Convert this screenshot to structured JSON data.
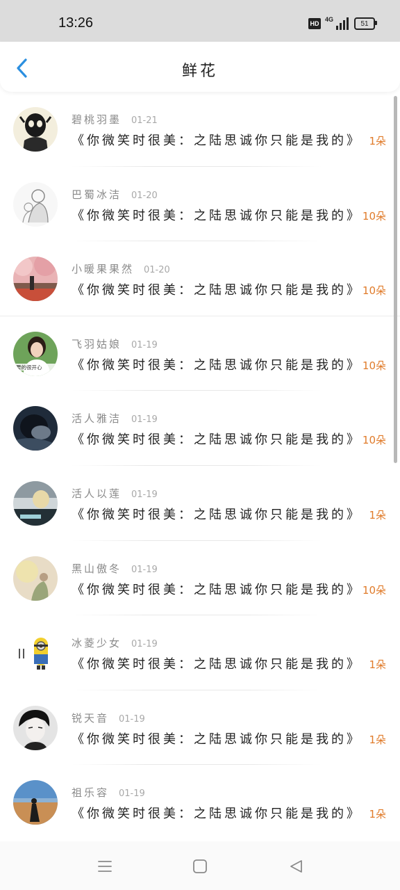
{
  "status_bar": {
    "time": "13:26",
    "hd": "HD",
    "network": "4G",
    "battery": "51"
  },
  "header": {
    "title": "鲜花",
    "back_icon": "chevron-left-icon",
    "accent": "#2b8fe0"
  },
  "colors": {
    "count": "#e07b2a"
  },
  "items": [
    {
      "name": "碧桃羽墨",
      "date": "01-21",
      "message": "《你微笑时很美：之陆思诚你只能是我的》",
      "count": "1朵"
    },
    {
      "name": "巴蜀冰洁",
      "date": "01-20",
      "message": "《你微笑时很美：之陆思诚你只能是我的》",
      "count": "10朵"
    },
    {
      "name": "小暖果果然",
      "date": "01-20",
      "message": "《你微笑时很美：之陆思诚你只能是我的》",
      "count": "10朵"
    },
    {
      "name": "飞羽姑娘",
      "date": "01-19",
      "message": "《你微笑时很美：之陆思诚你只能是我的》",
      "count": "10朵",
      "avatar_caption": "要的很开心"
    },
    {
      "name": "活人雅洁",
      "date": "01-19",
      "message": "《你微笑时很美：之陆思诚你只能是我的》",
      "count": "10朵"
    },
    {
      "name": "活人以莲",
      "date": "01-19",
      "message": "《你微笑时很美：之陆思诚你只能是我的》",
      "count": "1朵"
    },
    {
      "name": "黑山傲冬",
      "date": "01-19",
      "message": "《你微笑时很美：之陆思诚你只能是我的》",
      "count": "10朵"
    },
    {
      "name": "冰菱少女",
      "date": "01-19",
      "message": "《你微笑时很美：之陆思诚你只能是我的》",
      "count": "1朵"
    },
    {
      "name": "锐天音",
      "date": "01-19",
      "message": "《你微笑时很美：之陆思诚你只能是我的》",
      "count": "1朵"
    },
    {
      "name": "祖乐容",
      "date": "01-19",
      "message": "《你微笑时很美：之陆思诚你只能是我的》",
      "count": "1朵"
    }
  ],
  "nav_bar": {
    "menu_icon": "menu-icon",
    "home_icon": "home-square-icon",
    "back_icon": "back-triangle-icon"
  }
}
